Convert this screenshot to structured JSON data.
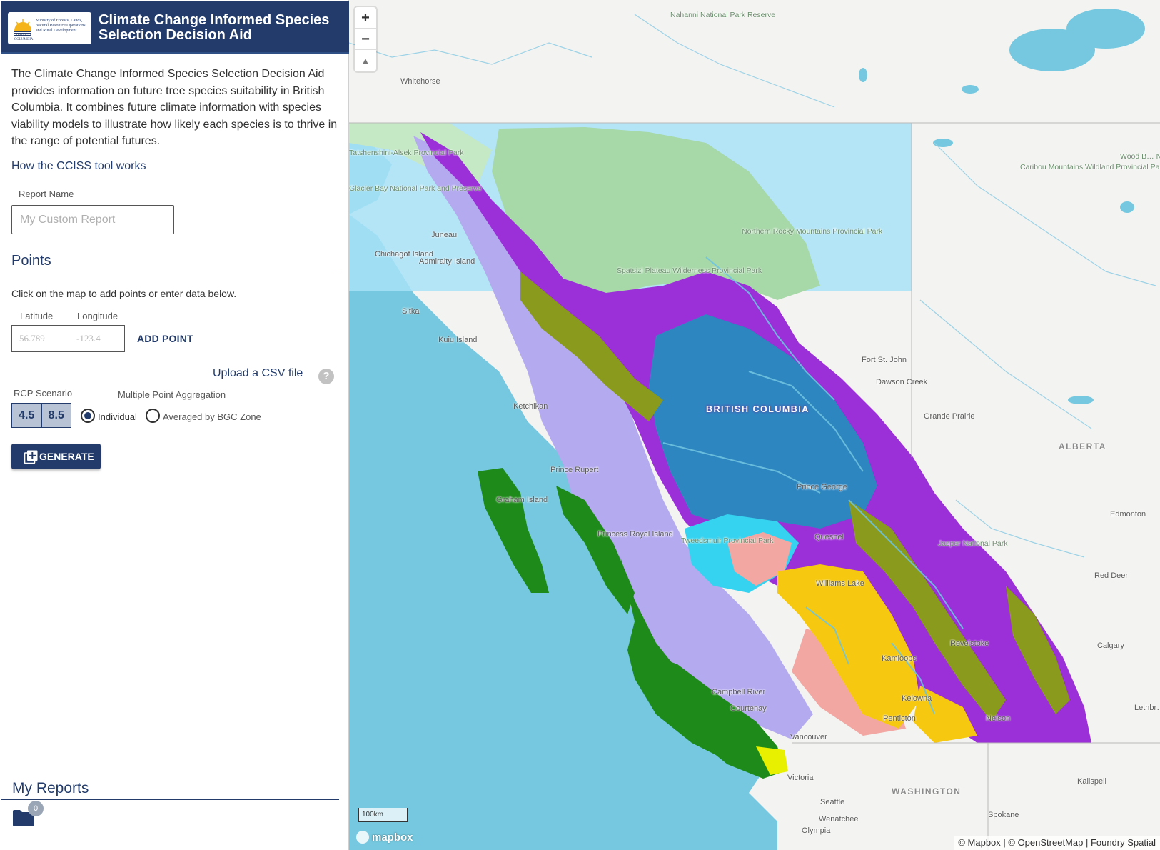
{
  "header": {
    "title": "Climate Change Informed Species Selection Decision Aid",
    "ministry_text": "Ministry of Forests, Lands, Natural Resource Operations and Rural Development",
    "gov_text": "BRITISH COLUMBIA"
  },
  "intro": {
    "text": "The Climate Change Informed Species Selection Decision Aid provides information on future tree species suitability in British Columbia. It combines future climate information with species viability models to illustrate how likely each species is to thrive in the range of potential futures.",
    "how_link": "How the CCISS tool works"
  },
  "report_name": {
    "label": "Report Name",
    "placeholder": "My Custom Report",
    "value": ""
  },
  "points": {
    "title": "Points",
    "help": "Click on the map to add points or enter data below.",
    "lat_label": "Latitude",
    "lon_label": "Longitude",
    "lat_placeholder": "56.789",
    "lon_placeholder": "-123.4",
    "add_label": "ADD POINT",
    "upload_label": "Upload a CSV file",
    "help_icon": "?"
  },
  "rcp": {
    "label": "RCP Scenario",
    "options": [
      "4.5",
      "8.5"
    ],
    "selected": [
      "4.5",
      "8.5"
    ]
  },
  "aggregation": {
    "label": "Multiple Point Aggregation",
    "options": [
      "Individual",
      "Averaged by BGC Zone"
    ],
    "selected": "Individual"
  },
  "generate_label": "GENERATE",
  "my_reports": {
    "title": "My Reports",
    "count": "0"
  },
  "map": {
    "zoom_in": "+",
    "zoom_out": "−",
    "compass": "▲",
    "scale_label": "100km",
    "logo": "mapbox",
    "attribution": "© Mapbox | © OpenStreetMap | Foundry Spatial",
    "labels": {
      "nahanni": "Nahanni National Park Reserve",
      "whitehorse": "Whitehorse",
      "juneau": "Juneau",
      "chichagof": "Chichagof Island",
      "admiralty": "Admiralty Island",
      "sitka": "Sitka",
      "kuiu": "Kuiu Island",
      "ketchikan": "Ketchikan",
      "glacier_bay": "Glacier Bay National Park and Preserve",
      "tatshenshini": "Tatshenshini-Alsek Provincial Park",
      "spatsizi": "Spatsizi Plateau Wilderness Provincial Park",
      "northern_rocky": "Northern Rocky Mountains Provincial Park",
      "fort_st_john": "Fort St. John",
      "dawson_creek": "Dawson Creek",
      "grande_prairie": "Grande Prairie",
      "caribou": "Caribou Mountains Wildland Provincial Park",
      "wood_buffalo": "Wood B… Nation…",
      "alberta": "ALBERTA",
      "edmonton": "Edmonton",
      "red_deer": "Red Deer",
      "calgary": "Calgary",
      "lethbridge": "Lethbr…",
      "british_columbia": "BRITISH COLUMBIA",
      "prince_rupert": "Prince Rupert",
      "graham": "Graham Island",
      "prince_george": "Prince George",
      "princess_royal": "Princess Royal Island",
      "tweedsmuir": "Tweedsmuir Provincial Park",
      "quesnel": "Quesnel",
      "williams_lake": "Williams Lake",
      "jasper": "Jasper National Park",
      "revelstoke": "Revelstoke",
      "kamloops": "Kamloops",
      "kelowna": "Kelowna",
      "penticton": "Penticton",
      "nelson": "Nelson",
      "campbell_river": "Campbell River",
      "courtenay": "Courtenay",
      "vancouver": "Vancouver",
      "victoria": "Victoria",
      "seattle": "Seattle",
      "olympia": "Olympia",
      "wenatchee": "Wenatchee",
      "spokane": "Spokane",
      "kalispell": "Kalispell",
      "washington": "WASHINGTON"
    }
  },
  "colors": {
    "header_bg": "#223b6b",
    "ocean": "#75c8df",
    "bgc_purple": "#9b2fd8",
    "bgc_blue": "#2e86c1",
    "bgc_lavender": "#b4aaf0",
    "bgc_green": "#1e8a1a",
    "bgc_olive": "#8a9a1c",
    "bgc_cyan": "#35d3f0",
    "bgc_yellow": "#f6c80f",
    "bgc_pink": "#f2a7a2",
    "bgc_lightgreen": "#a7d8a8",
    "bgc_skyblue": "#a8e2f8"
  }
}
